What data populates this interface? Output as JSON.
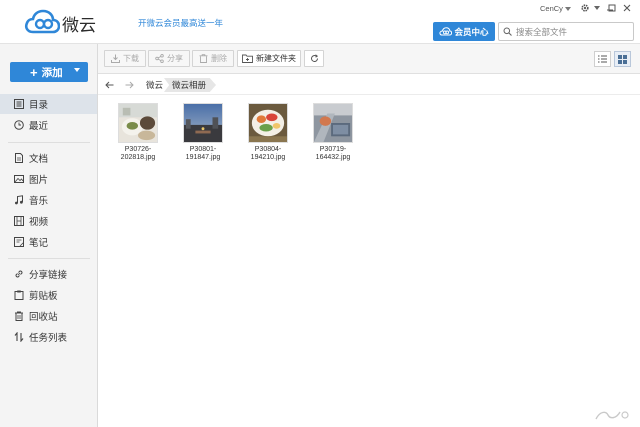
{
  "app": {
    "name": "微云",
    "promo": "开微云会员最高送一年"
  },
  "header": {
    "vip_label": "会员中心",
    "search_placeholder": "搜索全部文件",
    "user_name": "CenCy"
  },
  "sidebar": {
    "add_label": "添加",
    "items": [
      {
        "label": "目录",
        "icon": "catalog-icon"
      },
      {
        "label": "最近",
        "icon": "clock-icon"
      },
      {
        "label": "文档",
        "icon": "document-icon"
      },
      {
        "label": "图片",
        "icon": "image-icon"
      },
      {
        "label": "音乐",
        "icon": "music-icon"
      },
      {
        "label": "视频",
        "icon": "video-icon"
      },
      {
        "label": "笔记",
        "icon": "note-icon"
      },
      {
        "label": "分享链接",
        "icon": "link-icon"
      },
      {
        "label": "剪贴板",
        "icon": "clipboard-icon"
      },
      {
        "label": "回收站",
        "icon": "trash-icon"
      },
      {
        "label": "任务列表",
        "icon": "transfer-icon"
      }
    ]
  },
  "toolbar": {
    "download_label": "下载",
    "share_label": "分享",
    "delete_label": "删除",
    "new_folder_label": "新建文件夹"
  },
  "breadcrumb": {
    "root": "微云",
    "current": "微云相册"
  },
  "files": [
    {
      "name_line1": "P30726-",
      "name_line2": "202818.jpg"
    },
    {
      "name_line1": "P30801-",
      "name_line2": "191847.jpg"
    },
    {
      "name_line1": "P30804-",
      "name_line2": "194210.jpg"
    },
    {
      "name_line1": "P30719-",
      "name_line2": "164432.jpg"
    }
  ],
  "colors": {
    "accent": "#2f87d8",
    "sidebar_bg": "#f4f4f4",
    "active_item": "#dde3ea"
  }
}
